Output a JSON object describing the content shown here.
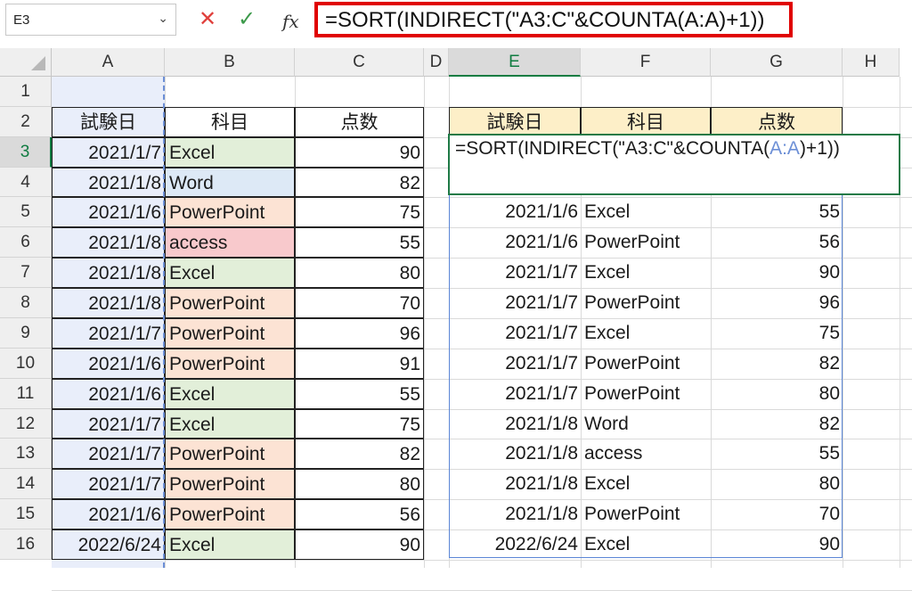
{
  "formula_bar": {
    "name_box": "E3",
    "formula": "=SORT(INDIRECT(\"A3:C\"&COUNTA(A:A)+1))",
    "cancel_icon": "✕",
    "enter_icon": "✓",
    "fx_label": "fx"
  },
  "column_headers": [
    "A",
    "B",
    "C",
    "D",
    "E",
    "F",
    "G",
    "H"
  ],
  "row_headers": [
    "1",
    "2",
    "3",
    "4",
    "5",
    "6",
    "7",
    "8",
    "9",
    "10",
    "11",
    "12",
    "13",
    "14",
    "15",
    "16"
  ],
  "left_table": {
    "headers": [
      "試験日",
      "科目",
      "点数"
    ],
    "rows": [
      [
        "2021/1/7",
        "Excel",
        "90"
      ],
      [
        "2021/1/8",
        "Word",
        "82"
      ],
      [
        "2021/1/6",
        "PowerPoint",
        "75"
      ],
      [
        "2021/1/8",
        "access",
        "55"
      ],
      [
        "2021/1/8",
        "Excel",
        "80"
      ],
      [
        "2021/1/8",
        "PowerPoint",
        "70"
      ],
      [
        "2021/1/7",
        "PowerPoint",
        "96"
      ],
      [
        "2021/1/6",
        "PowerPoint",
        "91"
      ],
      [
        "2021/1/6",
        "Excel",
        "55"
      ],
      [
        "2021/1/7",
        "Excel",
        "75"
      ],
      [
        "2021/1/7",
        "PowerPoint",
        "82"
      ],
      [
        "2021/1/7",
        "PowerPoint",
        "80"
      ],
      [
        "2021/1/6",
        "PowerPoint",
        "56"
      ],
      [
        "2022/6/24",
        "Excel",
        "90"
      ]
    ]
  },
  "right_table": {
    "headers": [
      "試験日",
      "科目",
      "点数"
    ],
    "editing_formula_parts": [
      "=SORT(INDIRECT(\"A3:C\"&COUNTA(",
      "A:A",
      ")+1))"
    ],
    "rows": [
      [
        "2021/1/6",
        "Excel",
        "55"
      ],
      [
        "2021/1/6",
        "PowerPoint",
        "56"
      ],
      [
        "2021/1/7",
        "Excel",
        "90"
      ],
      [
        "2021/1/7",
        "PowerPoint",
        "96"
      ],
      [
        "2021/1/7",
        "Excel",
        "75"
      ],
      [
        "2021/1/7",
        "PowerPoint",
        "82"
      ],
      [
        "2021/1/7",
        "PowerPoint",
        "80"
      ],
      [
        "2021/1/8",
        "Word",
        "82"
      ],
      [
        "2021/1/8",
        "access",
        "55"
      ],
      [
        "2021/1/8",
        "Excel",
        "80"
      ],
      [
        "2021/1/8",
        "PowerPoint",
        "70"
      ],
      [
        "2022/6/24",
        "Excel",
        "90"
      ]
    ]
  },
  "colors": {
    "header_fill": "#fdefc8",
    "subject_excel": "#e2efd9",
    "subject_word": "#dde9f6",
    "subject_powerpoint": "#fce3d4",
    "subject_access": "#f8c9cc",
    "accent_green": "#107c41",
    "formula_highlight": "#e00000"
  }
}
